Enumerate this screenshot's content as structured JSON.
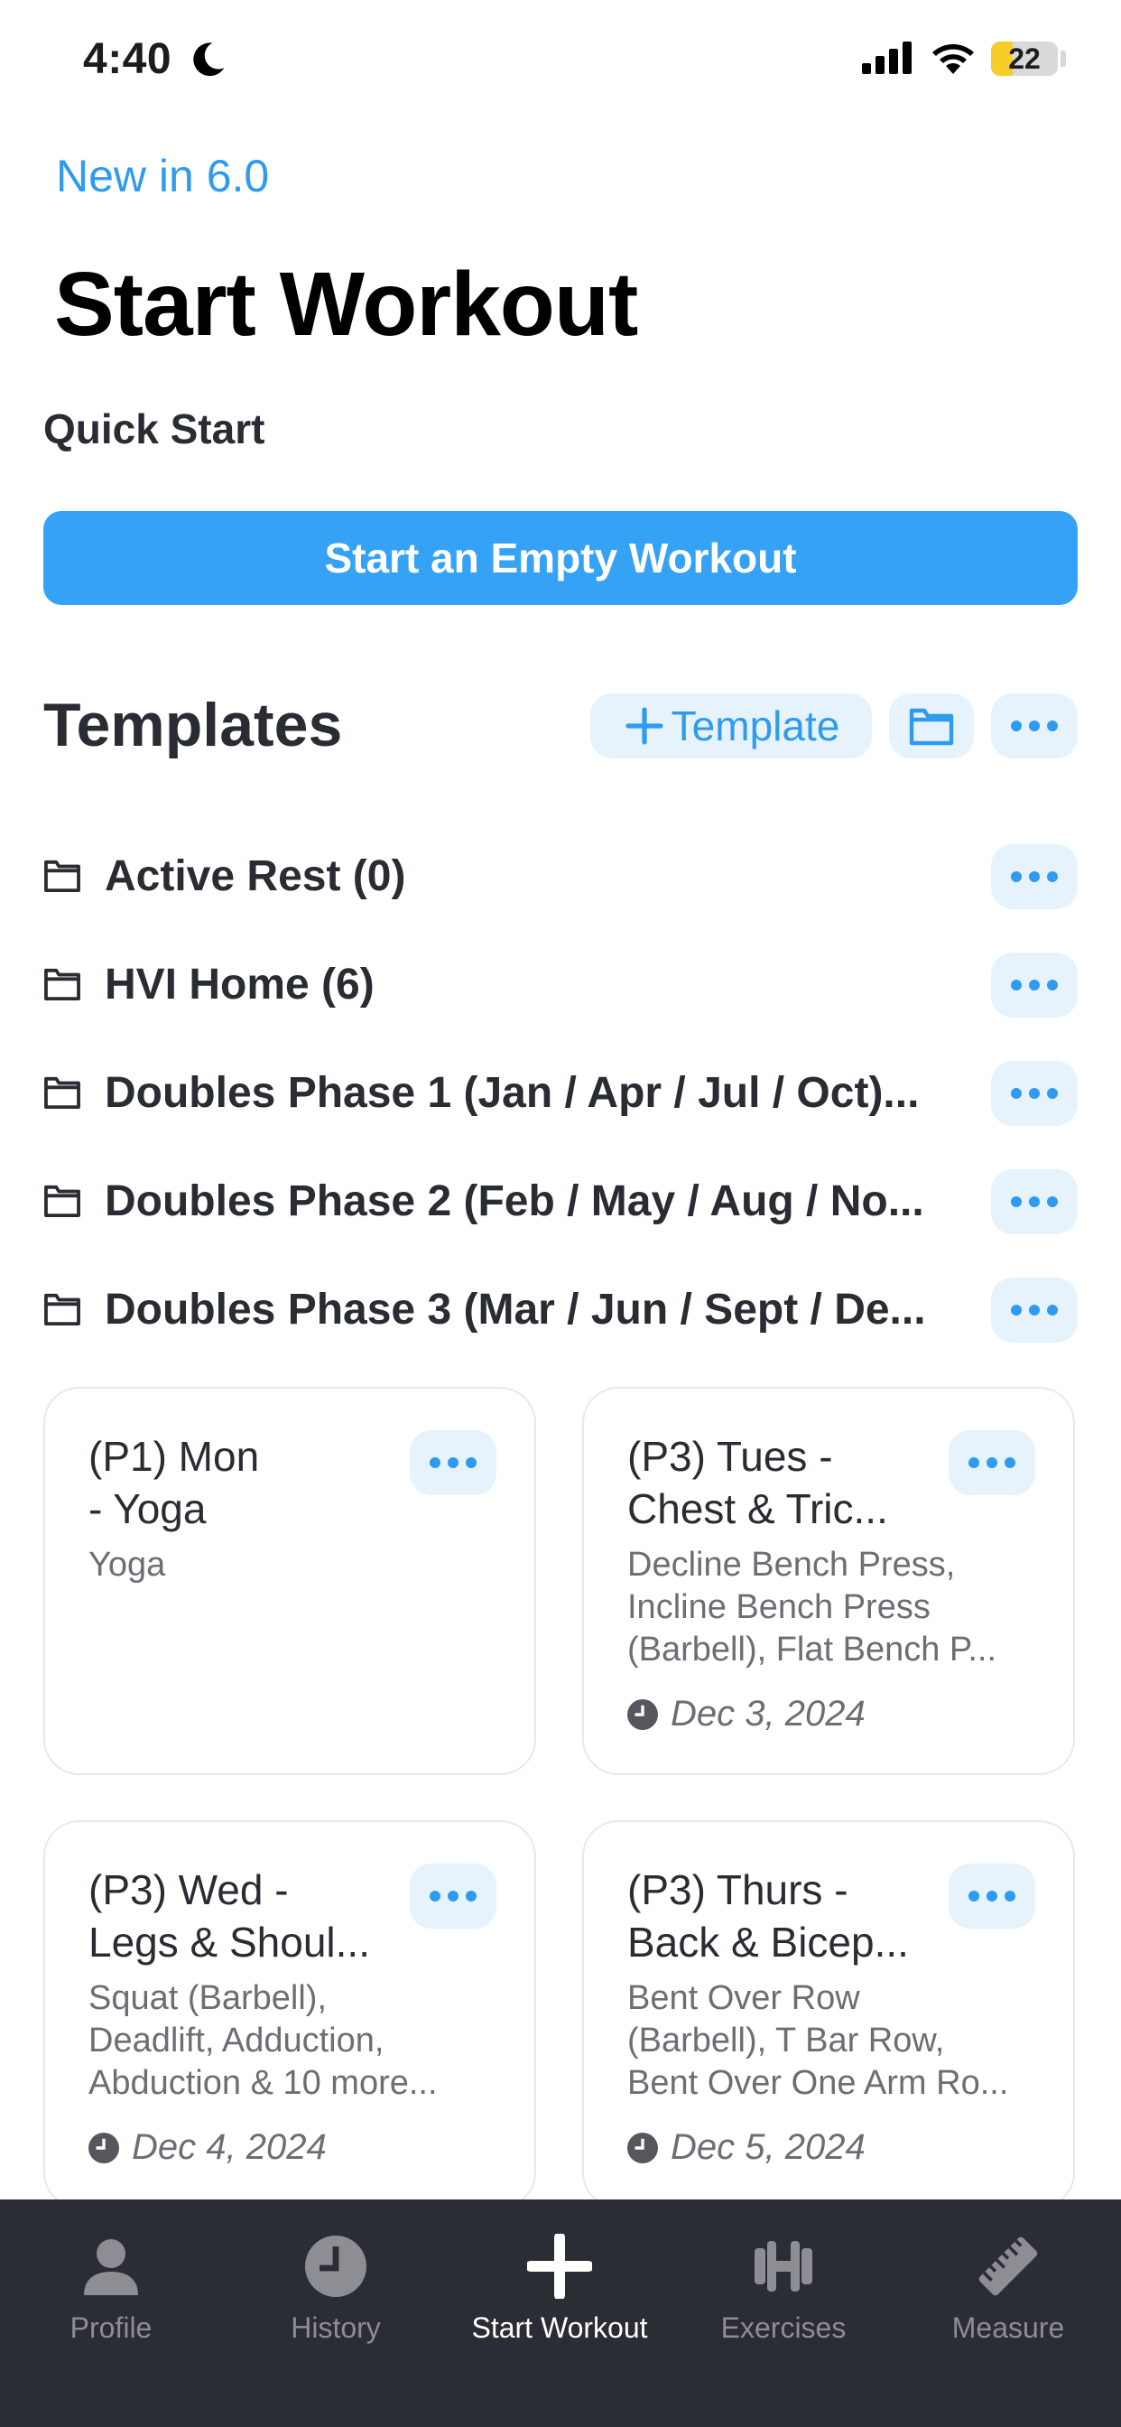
{
  "status_bar": {
    "time": "4:40",
    "battery": "22",
    "battery_level": 0.22
  },
  "header": {
    "new_link": "New in 6.0",
    "title": "Start Workout",
    "quick_start_label": "Quick Start",
    "empty_workout_button": "Start an Empty Workout"
  },
  "templates": {
    "heading": "Templates",
    "add_template_label": "Template",
    "folders": [
      {
        "name": "Active Rest (0)"
      },
      {
        "name": "HVI Home (6)"
      },
      {
        "name": "Doubles Phase 1 (Jan / Apr / Jul / Oct)..."
      },
      {
        "name": "Doubles Phase 2 (Feb / May / Aug / No..."
      },
      {
        "name": "Doubles Phase 3 (Mar / Jun / Sept / De..."
      }
    ],
    "cards": [
      {
        "title_line1": "(P1) Mon",
        "title_line2": "- Yoga",
        "desc_line1": "Yoga",
        "desc_line2": "",
        "desc_line3": "",
        "date": ""
      },
      {
        "title_line1": "(P3) Tues -",
        "title_line2": "Chest & Tric...",
        "desc_line1": "Decline Bench Press,",
        "desc_line2": "Incline Bench Press",
        "desc_line3": "(Barbell), Flat Bench P...",
        "date": "Dec 3, 2024"
      },
      {
        "title_line1": "(P3) Wed -",
        "title_line2": "Legs & Shoul...",
        "desc_line1": "Squat (Barbell),",
        "desc_line2": "Deadlift, Adduction,",
        "desc_line3": "Abduction & 10 more...",
        "date": "Dec 4, 2024"
      },
      {
        "title_line1": "(P3) Thurs -",
        "title_line2": "Back & Bicep...",
        "desc_line1": "Bent Over Row",
        "desc_line2": "(Barbell), T Bar Row,",
        "desc_line3": "Bent Over One Arm Ro...",
        "date": "Dec 5, 2024"
      }
    ]
  },
  "tab_bar": {
    "tabs": [
      {
        "label": "Profile",
        "icon": "person-icon"
      },
      {
        "label": "History",
        "icon": "clock-icon"
      },
      {
        "label": "Start Workout",
        "icon": "plus-icon"
      },
      {
        "label": "Exercises",
        "icon": "dumbbell-icon"
      },
      {
        "label": "Measure",
        "icon": "ruler-icon"
      }
    ],
    "active_tab": "Start Workout"
  },
  "colors": {
    "accent": "#2e9bf0",
    "button": "#35a2f5",
    "tab_bar_bg": "#2b2d35",
    "battery_yellow": "#f7ce29"
  }
}
